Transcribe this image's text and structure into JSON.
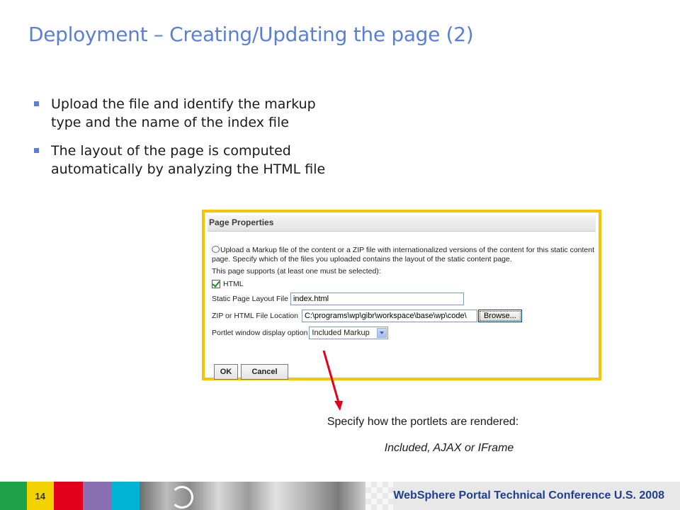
{
  "slide": {
    "title": "Deployment – Creating/Updating the page (2)",
    "bullets": [
      "Upload the file and identify the markup type and the name of the index file",
      "The layout of the page is computed automatically by analyzing the HTML file"
    ]
  },
  "dialog": {
    "header": "Page Properties",
    "help_text": "Upload a Markup file of the content or a ZIP file with internationalized versions of the content for this static content page. Specify which of the files you uploaded contains the layout of the static content page.",
    "supports_text": "This page supports (at least one must be selected):",
    "html_checkbox_label": "HTML",
    "html_checkbox_checked": true,
    "layout_file_label": "Static Page Layout File",
    "layout_file_value": "index.html",
    "location_label": "ZIP or HTML File Location",
    "location_value": "C:\\programs\\wp\\gibr\\workspace\\base\\wp\\code\\",
    "browse_label": "Browse...",
    "display_option_label": "Portlet window display option",
    "display_option_value": "Included Markup",
    "ok_label": "OK",
    "cancel_label": "Cancel"
  },
  "annotation": {
    "line1": "Specify how the portlets are rendered:",
    "line2": "Included, AJAX or IFrame",
    "arrow_color": "#e3001b"
  },
  "footer": {
    "page_number": "14",
    "conference": "WebSphere Portal Technical Conference U.S. 2008",
    "colors": [
      "#1fa34a",
      "#f2d300",
      "#e3001b",
      "#8b6fb3",
      "#00b2d3"
    ]
  },
  "theme": {
    "title_color": "#5b7fd6",
    "frame_color": "#f3c700"
  }
}
